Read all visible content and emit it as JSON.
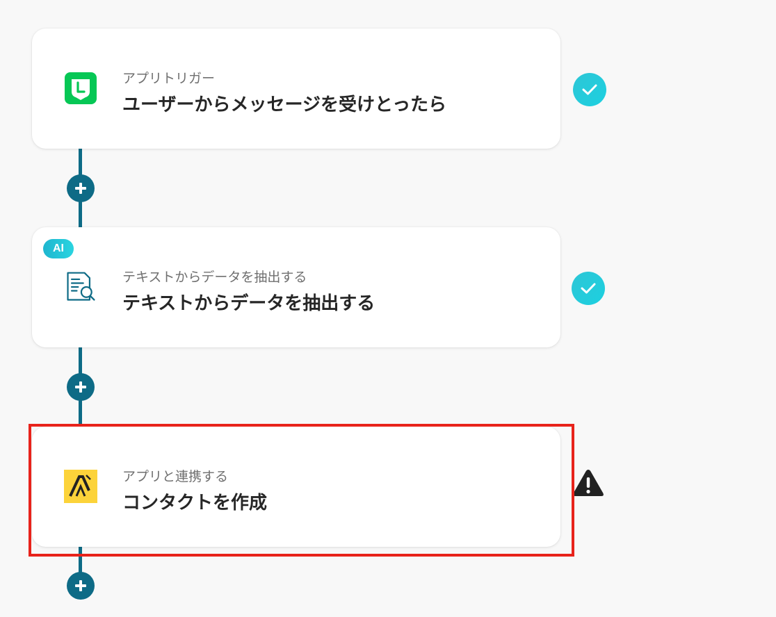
{
  "steps": [
    {
      "subtitle": "アプリトリガー",
      "title": "ユーザーからメッセージを受けとったら",
      "icon": "line-app-icon",
      "status": "completed",
      "status_icon": "check-icon"
    },
    {
      "badge": "AI",
      "subtitle": "テキストからデータを抽出する",
      "title": "テキストからデータを抽出する",
      "icon": "document-search-icon",
      "status": "completed",
      "status_icon": "check-icon"
    },
    {
      "subtitle": "アプリと連携する",
      "title": "コンタクトを作成",
      "icon": "app-logo-icon",
      "status": "warning",
      "status_icon": "warning-icon",
      "highlighted": true
    }
  ],
  "colors": {
    "connector": "#0e6b86",
    "check": "#26c9d9",
    "highlight": "#e8231b",
    "line_green": "#06c755",
    "app_yellow": "#fcd33a"
  }
}
